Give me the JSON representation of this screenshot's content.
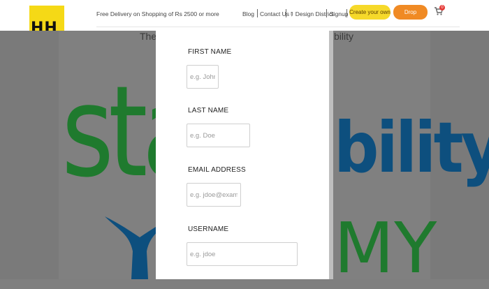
{
  "header": {
    "logo_text": "HH",
    "delivery_text": "Free Delivery on Shopping of Rs 2500 or more",
    "nav": {
      "blog": "Blog",
      "contact": "Contact Us",
      "design_district": "Design District",
      "signup": "Signup"
    },
    "create_button": "Create your own",
    "complaint_button": "Drop Complaint",
    "cart_count": "0"
  },
  "background": {
    "tagline_left": "The e",
    "tagline_right": "bility",
    "word_green": "sta",
    "word_blue": "bility",
    "word_green_2": "MY"
  },
  "form": {
    "first_name": {
      "label": "FIRST NAME",
      "placeholder": "e.g. John"
    },
    "last_name": {
      "label": "LAST NAME",
      "placeholder": "e.g. Doe"
    },
    "email": {
      "label": "EMAIL ADDRESS",
      "placeholder": "e.g. jdoe@example.com"
    },
    "username": {
      "label": "USERNAME",
      "placeholder": "e.g. jdoe"
    }
  },
  "colors": {
    "brand_yellow": "#f5d916",
    "create_button": "#f6d92a",
    "complaint_button": "#f08a24",
    "cart_badge": "#e53935",
    "overlay_gray": "#7f7f7f"
  }
}
